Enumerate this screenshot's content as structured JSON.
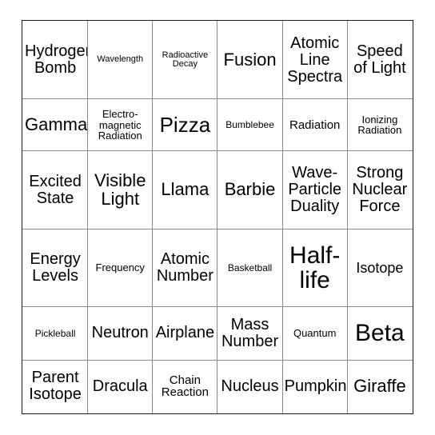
{
  "card": {
    "type": "bingo-card",
    "columns": 6,
    "rows": 6,
    "background_color": "#ffffff",
    "text_color": "#000000",
    "inner_border_color": "#8a8a8a",
    "outer_border_color": "#1b1b1b",
    "cells": [
      [
        {
          "text": "Hydrogen Bomb",
          "size": "md"
        },
        {
          "text": "Wavelength",
          "size": "min"
        },
        {
          "text": "Radioactive Decay",
          "size": "min"
        },
        {
          "text": "Fusion",
          "size": "lg"
        },
        {
          "text": "Atomic Line Spectra",
          "size": "md"
        },
        {
          "text": "Speed of Light",
          "size": "md"
        }
      ],
      [
        {
          "text": "Gamma",
          "size": "lg"
        },
        {
          "text": "Electro-magnetic Radiation",
          "size": "xxs"
        },
        {
          "text": "Pizza",
          "size": "xl"
        },
        {
          "text": "Bumblebee",
          "size": "tiny"
        },
        {
          "text": "Radiation",
          "size": "xs"
        },
        {
          "text": "Ionizing Radiation",
          "size": "xxs"
        }
      ],
      [
        {
          "text": "Excited State",
          "size": "md"
        },
        {
          "text": "Visible Light",
          "size": "lg"
        },
        {
          "text": "Llama",
          "size": "lg"
        },
        {
          "text": "Barbie",
          "size": "lg"
        },
        {
          "text": "Wave-Particle Duality",
          "size": "md"
        },
        {
          "text": "Strong Nuclear Force",
          "size": "md"
        }
      ],
      [
        {
          "text": "Energy Levels",
          "size": "md"
        },
        {
          "text": "Frequency",
          "size": "xxs"
        },
        {
          "text": "Atomic Number",
          "size": "md"
        },
        {
          "text": "Basketball",
          "size": "tiny"
        },
        {
          "text": "Half-life",
          "size": "xxl"
        },
        {
          "text": "Isotope",
          "size": "sm"
        }
      ],
      [
        {
          "text": "Pickleball",
          "size": "tiny"
        },
        {
          "text": "Neutron",
          "size": "md"
        },
        {
          "text": "Airplane",
          "size": "md"
        },
        {
          "text": "Mass Number",
          "size": "md"
        },
        {
          "text": "Quantum",
          "size": "xxs"
        },
        {
          "text": "Beta",
          "size": "xxl"
        }
      ],
      [
        {
          "text": "Parent Isotope",
          "size": "md"
        },
        {
          "text": "Dracula",
          "size": "md"
        },
        {
          "text": "Chain Reaction",
          "size": "xs"
        },
        {
          "text": "Nucleus",
          "size": "md"
        },
        {
          "text": "Pumpkin",
          "size": "md"
        },
        {
          "text": "Giraffe",
          "size": "lg"
        }
      ]
    ]
  }
}
